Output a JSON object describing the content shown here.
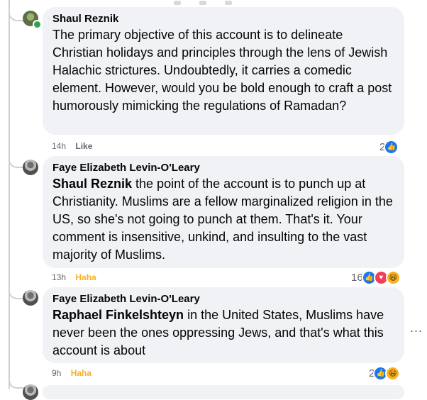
{
  "comments": [
    {
      "author": "Shaul Reznik",
      "mention": "",
      "text": "The primary objective of this account is to delineate Christian holidays and principles through the lens of Jewish Halachic strictures. Undoubtedly, it carries a comedic element. However, would you be bold enough to craft a post humorously mimicking the regulations of Ramadan?",
      "time": "14h",
      "action": "Like",
      "reaction_count": "2",
      "reactions": [
        "like-icon"
      ],
      "online": true
    },
    {
      "author": "Faye Elizabeth Levin-O'Leary",
      "mention": "Shaul Reznik",
      "text": " the point of the account is to punch up at Christianity. Muslims are a fellow marginalized religion in the US, so she's not going to punch at them. That's it. Your comment is insensitive, unkind, and insulting to the vast majority of Muslims.",
      "time": "13h",
      "action": "Haha",
      "reaction_count": "16",
      "reactions": [
        "like-icon",
        "love-icon",
        "haha-icon"
      ],
      "online": false
    },
    {
      "author": "Faye Elizabeth Levin-O'Leary",
      "mention": "Raphael Finkelshteyn",
      "text": " in the United States, Muslims have never been the ones oppressing Jews, and that's what this account is about",
      "time": "9h",
      "action": "Haha",
      "reaction_count": "2",
      "reactions": [
        "like-icon",
        "haha-icon"
      ],
      "online": false
    }
  ],
  "more_menu": "...",
  "icons": {
    "like": "👍",
    "love": "♥",
    "haha": "😆"
  },
  "colors": {
    "like": "#1877f2",
    "love": "#f33e58",
    "haha": "#f7b125",
    "bubble": "#f0f2f5"
  }
}
